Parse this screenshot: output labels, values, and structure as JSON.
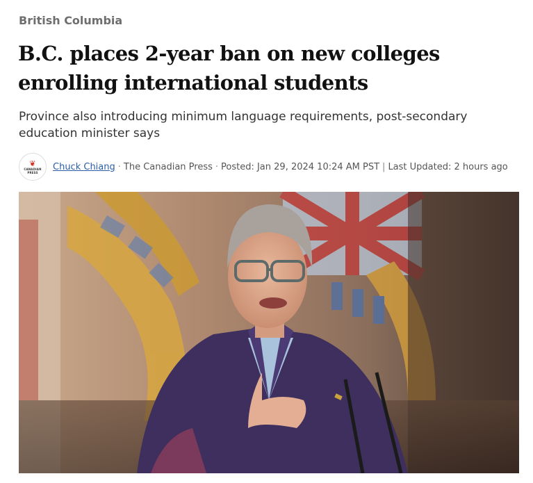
{
  "section": "British Columbia",
  "headline": "B.C. places 2-year ban on new colleges enrolling international students",
  "deck": "Province also introducing minimum language requirements, post-secondary education minister says",
  "byline": {
    "logo_alt": "CANADIAN PRESS",
    "author": "Chuck Chiang",
    "source": "The Canadian Press",
    "posted": "Posted: Jan 29, 2024 10:24 AM PST",
    "updated": "Last Updated: 2 hours ago"
  },
  "colors": {
    "link": "#2a5ea8",
    "headline": "#111111",
    "section": "#6e6e6e",
    "brand_red": "#d52b1e"
  }
}
